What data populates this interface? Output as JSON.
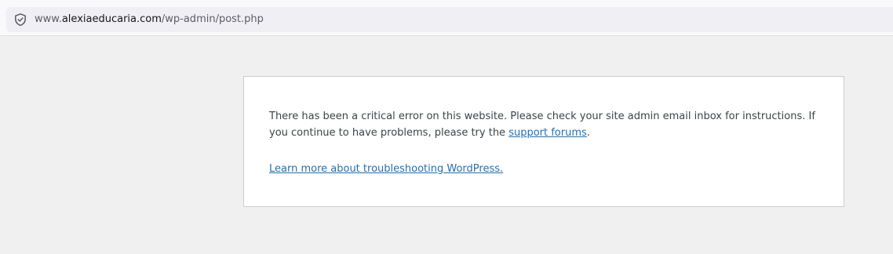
{
  "browser": {
    "url_prefix": "www.",
    "url_domain": "alexiaeducaria.com",
    "url_path": "/wp-admin/post.php"
  },
  "error": {
    "message_part1": "There has been a critical error on this website. Please check your site admin email inbox for instructions. If you continue to have problems, please try the ",
    "support_link": "support forums",
    "message_part2": ".",
    "learn_more_link": "Learn more about troubleshooting WordPress."
  },
  "colors": {
    "page_background": "#f0f0f0",
    "box_background": "#ffffff",
    "link": "#2271b1",
    "text": "#3c434a"
  },
  "icons": {
    "address_bar_icon": "shield-icon"
  }
}
